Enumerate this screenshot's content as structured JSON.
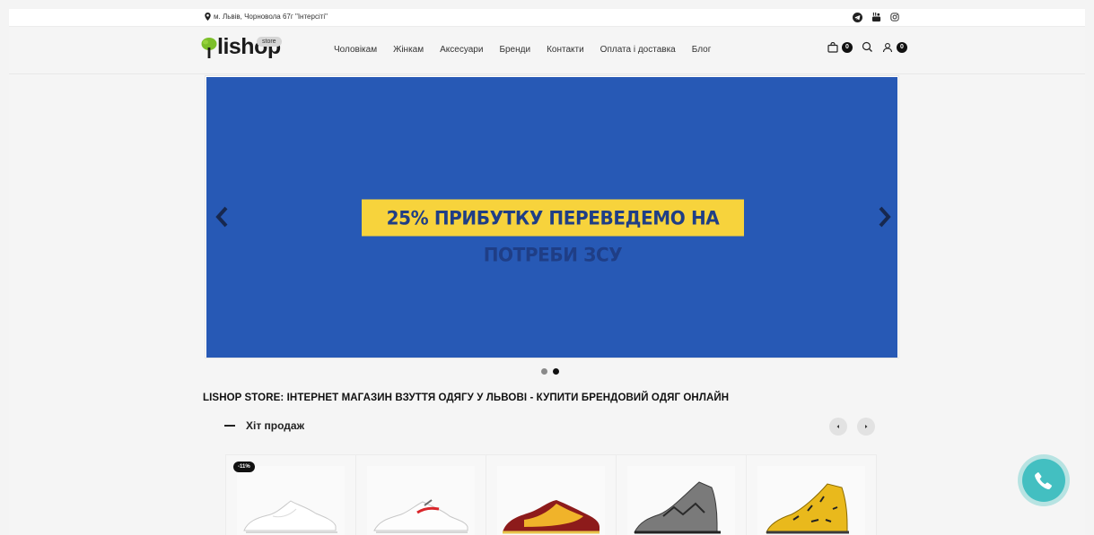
{
  "topbar": {
    "address": "м. Львів, Чорновола 67г \"Інтерсіті\"",
    "social_icons": [
      "telegram-icon",
      "youtube-icon",
      "instagram-icon"
    ]
  },
  "header": {
    "logo_text": "lishop",
    "logo_badge": "store",
    "nav": [
      "Чоловікам",
      "Жінкам",
      "Аксесуари",
      "Бренди",
      "Контакти",
      "Оплата і доставка",
      "Блог"
    ],
    "cart_count": "0",
    "account_count": "0"
  },
  "slider": {
    "banner_text": "25% ПРИБУТКУ ПЕРЕВЕДЕМО НА ПОТРЕБИ ЗСУ",
    "background_color": "#2759b5",
    "banner_color": "#f7d33c",
    "dots": 2,
    "active_dot": 2
  },
  "page_heading": "LISHOP STORE: ІНТЕРНЕТ МАГАЗИН ВЗУТТЯ ОДЯГУ У ЛЬВОВІ - КУПИТИ БРЕНДОВИЙ ОДЯГ ОНЛАЙН",
  "section": {
    "title": "Хіт продаж"
  },
  "products": [
    {
      "name": "white-sneaker-product",
      "badge": "-11%"
    },
    {
      "name": "white-red-sneaker-product",
      "badge": ""
    },
    {
      "name": "red-yellow-dunk-product",
      "badge": ""
    },
    {
      "name": "grey-high-top-product",
      "badge": ""
    },
    {
      "name": "yellow-high-top-product",
      "badge": ""
    }
  ],
  "call_button": {
    "icon": "phone-icon",
    "color": "#43bfc1"
  }
}
